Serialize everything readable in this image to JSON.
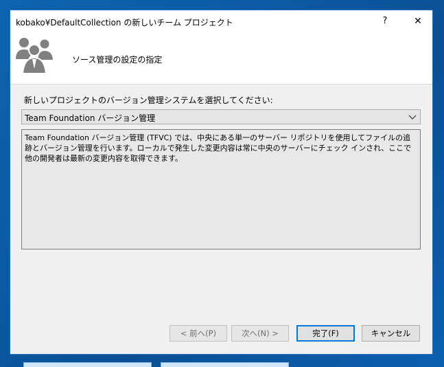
{
  "window": {
    "title": "kobako¥DefaultCollection の新しいチーム プロジェクト",
    "help_glyph": "?",
    "close_glyph": "✕"
  },
  "banner": {
    "title": "ソース管理の設定の指定",
    "icon": "team-people-icon"
  },
  "form": {
    "prompt_label": "新しいプロジェクトのバージョン管理システムを選択してください:",
    "vcs_select": {
      "selected": "Team Foundation バージョン管理"
    },
    "description": "Team Foundation バージョン管理 (TFVC) では、中央にある単一のサーバー リポジトリを使用してファイルの追跡とバージョン管理を行います。ローカルで発生した変更内容は常に中央のサーバーにチェック インされ、ここで他の開発者は最新の変更内容を取得できます。"
  },
  "buttons": {
    "prev_label": "< 前へ(P)",
    "next_label": "次へ(N) >",
    "finish_label": "完了(F)",
    "cancel_label": "キャンセル"
  },
  "colors": {
    "desktop": "#0b5aa3",
    "window_border": "#1e73c4",
    "icon_gray": "#808080",
    "default_button_border": "#0078d7"
  }
}
